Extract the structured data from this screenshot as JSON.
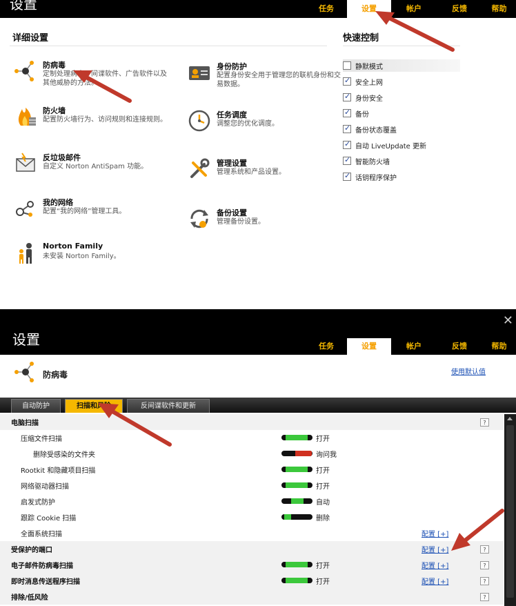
{
  "top": {
    "window_title": "设置",
    "nav": [
      "任务",
      "设置",
      "帐户",
      "反馈",
      "帮助"
    ],
    "detail_title": "详细设置",
    "quick_title": "快速控制",
    "items_left": [
      {
        "name": "防病毒",
        "desc": "定制处理病毒、间谍软件、广告软件以及其他威胁的方法。",
        "icon": "antivirus-icon"
      },
      {
        "name": "防火墙",
        "desc": "配置防火墙行为、访问规则和连接规则。",
        "icon": "firewall-icon"
      },
      {
        "name": "反垃圾邮件",
        "desc": "自定义 Norton AntiSpam 功能。",
        "icon": "antispam-icon"
      },
      {
        "name": "我的网络",
        "desc": "配置“我的网络”管理工具。",
        "icon": "network-icon"
      },
      {
        "name": "Norton Family",
        "desc": "未安装 Norton Family。",
        "icon": "family-icon"
      }
    ],
    "items_right": [
      {
        "name": "身份防护",
        "desc": "配置身份安全用于管理您的联机身份和交易数据。",
        "icon": "identity-icon"
      },
      {
        "name": "任务调度",
        "desc": "调整您的优化调度。",
        "icon": "clock-icon"
      },
      {
        "name": "管理设置",
        "desc": "管理系统和产品设置。",
        "icon": "tools-icon"
      },
      {
        "name": "备份设置",
        "desc": "管理备份设置。",
        "icon": "backup-icon"
      }
    ],
    "quick_controls": [
      {
        "label": "静默模式",
        "checked": false
      },
      {
        "label": "安全上网",
        "checked": true
      },
      {
        "label": "身份安全",
        "checked": true
      },
      {
        "label": "备份",
        "checked": true
      },
      {
        "label": "备份状态覆盖",
        "checked": true
      },
      {
        "label": "自动 LiveUpdate 更新",
        "checked": true
      },
      {
        "label": "智能防火墙",
        "checked": true
      },
      {
        "label": "话钥程序保护",
        "checked": true
      }
    ]
  },
  "bottom": {
    "window_title": "设置",
    "nav": [
      "任务",
      "设置",
      "帐户",
      "反馈",
      "帮助"
    ],
    "section_name": "防病毒",
    "defaults_link": "使用默认值",
    "tabs": [
      "自动防护",
      "扫描和风险",
      "反间谍软件和更新"
    ],
    "rows": [
      {
        "label": "电脑扫描",
        "section": true,
        "help": true
      },
      {
        "label": "压缩文件扫描",
        "toggle": "on",
        "status": "打开"
      },
      {
        "label": "删除受感染的文件夹",
        "toggle": "ask",
        "status": "询问我",
        "indent": 2
      },
      {
        "label": "Rootkit 和隐藏项目扫描",
        "toggle": "on",
        "status": "打开"
      },
      {
        "label": "网络驱动器扫描",
        "toggle": "on",
        "status": "打开"
      },
      {
        "label": "启发式防护",
        "toggle": "auto",
        "status": "自动"
      },
      {
        "label": "跟踪 Cookie 扫描",
        "toggle": "remove",
        "status": "删除"
      },
      {
        "label": "全面系统扫描",
        "config": "配置 [+]"
      },
      {
        "label": "受保护的端口",
        "section": true,
        "config": "配置 [+]",
        "help": true
      },
      {
        "label": "电子邮件防病毒扫描",
        "section": true,
        "toggle": "on",
        "status": "打开",
        "config": "配置 [+]",
        "help": true
      },
      {
        "label": "即时消息传送程序扫描",
        "section": true,
        "toggle": "on",
        "status": "打开",
        "config": "配置 [+]",
        "help": true
      },
      {
        "label": "排除/低风险",
        "section": true,
        "help": true
      }
    ],
    "help_glyph": "?"
  },
  "colors": {
    "accent": "#f5b800",
    "toggle_on": "#3cc83c",
    "toggle_ask": "#d03020",
    "link": "#1a4fb4",
    "arrow": "#c0392b"
  }
}
